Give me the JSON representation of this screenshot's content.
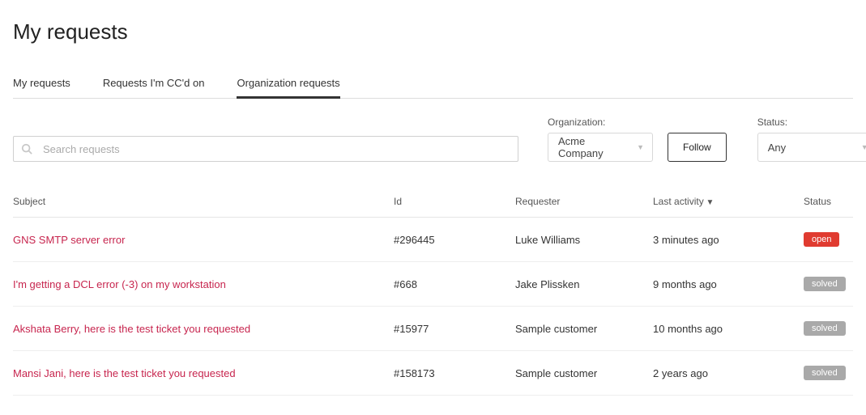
{
  "page": {
    "title": "My requests"
  },
  "tabs": [
    {
      "label": "My requests",
      "active": false
    },
    {
      "label": "Requests I'm CC'd on",
      "active": false
    },
    {
      "label": "Organization requests",
      "active": true
    }
  ],
  "search": {
    "placeholder": "Search requests"
  },
  "filters": {
    "org_label": "Organization:",
    "org_value": "Acme Company",
    "follow_label": "Follow",
    "status_label": "Status:",
    "status_value": "Any"
  },
  "table": {
    "headers": {
      "subject": "Subject",
      "id": "Id",
      "requester": "Requester",
      "last_activity": "Last activity",
      "status": "Status"
    },
    "rows": [
      {
        "subject": "GNS SMTP server error",
        "id": "#296445",
        "requester": "Luke Williams",
        "last_activity": "3 minutes ago",
        "status": "open",
        "status_class": "open"
      },
      {
        "subject": "I'm getting a DCL error (-3) on my workstation",
        "id": "#668",
        "requester": "Jake Plissken",
        "last_activity": "9 months ago",
        "status": "solved",
        "status_class": "solved"
      },
      {
        "subject": "Akshata Berry, here is the test ticket you requested",
        "id": "#15977",
        "requester": "Sample customer",
        "last_activity": "10 months ago",
        "status": "solved",
        "status_class": "solved"
      },
      {
        "subject": "Mansi Jani, here is the test ticket you requested",
        "id": "#158173",
        "requester": "Sample customer",
        "last_activity": "2 years ago",
        "status": "solved",
        "status_class": "solved"
      }
    ]
  }
}
